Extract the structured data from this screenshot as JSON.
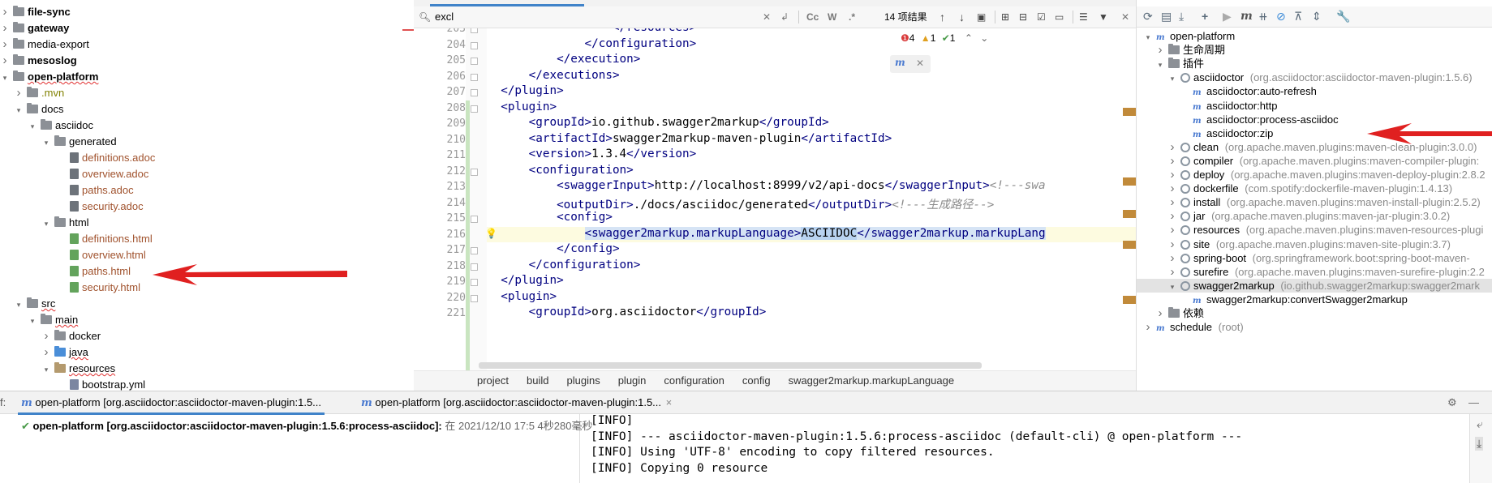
{
  "project_tree": [
    {
      "label": "file-sync",
      "style": "bold",
      "arrow": "right",
      "icon": "folder",
      "depth": 0
    },
    {
      "label": "gateway",
      "style": "bold",
      "arrow": "right",
      "icon": "folder",
      "depth": 0
    },
    {
      "label": "media-export",
      "style": "normal",
      "arrow": "right",
      "icon": "folder",
      "depth": 0
    },
    {
      "label": "mesoslog",
      "style": "bold",
      "arrow": "right",
      "icon": "folder",
      "depth": 0
    },
    {
      "label": "open-platform",
      "style": "bold-squig",
      "arrow": "down",
      "icon": "folder",
      "depth": 0
    },
    {
      "label": ".mvn",
      "style": "olive",
      "arrow": "right",
      "icon": "folder",
      "depth": 1
    },
    {
      "label": "docs",
      "style": "normal",
      "arrow": "down",
      "icon": "folder",
      "depth": 1
    },
    {
      "label": "asciidoc",
      "style": "normal",
      "arrow": "down",
      "icon": "folder",
      "depth": 2
    },
    {
      "label": "generated",
      "style": "normal",
      "arrow": "down",
      "icon": "folder",
      "depth": 3
    },
    {
      "label": "definitions.adoc",
      "style": "orange",
      "arrow": "",
      "icon": "file",
      "depth": 4
    },
    {
      "label": "overview.adoc",
      "style": "orange",
      "arrow": "",
      "icon": "file",
      "depth": 4
    },
    {
      "label": "paths.adoc",
      "style": "orange",
      "arrow": "",
      "icon": "file",
      "depth": 4
    },
    {
      "label": "security.adoc",
      "style": "orange",
      "arrow": "",
      "icon": "file",
      "depth": 4
    },
    {
      "label": "html",
      "style": "normal",
      "arrow": "down",
      "icon": "folder",
      "depth": 3
    },
    {
      "label": "definitions.html",
      "style": "orange",
      "arrow": "",
      "icon": "html",
      "depth": 4
    },
    {
      "label": "overview.html",
      "style": "orange",
      "arrow": "",
      "icon": "html",
      "depth": 4
    },
    {
      "label": "paths.html",
      "style": "orange",
      "arrow": "",
      "icon": "html",
      "depth": 4
    },
    {
      "label": "security.html",
      "style": "orange",
      "arrow": "",
      "icon": "html",
      "depth": 4
    },
    {
      "label": "src",
      "style": "squig",
      "arrow": "down",
      "icon": "folder",
      "depth": 1
    },
    {
      "label": "main",
      "style": "squig",
      "arrow": "down",
      "icon": "folder",
      "depth": 2
    },
    {
      "label": "docker",
      "style": "normal",
      "arrow": "right",
      "icon": "folder",
      "depth": 3
    },
    {
      "label": "java",
      "style": "squig",
      "arrow": "right",
      "icon": "folder-blue",
      "depth": 3
    },
    {
      "label": "resources",
      "style": "squig",
      "arrow": "down",
      "icon": "folder-tan",
      "depth": 3
    },
    {
      "label": "bootstrap.yml",
      "style": "normal",
      "arrow": "",
      "icon": "yml",
      "depth": 4
    }
  ],
  "search": {
    "value": "excl",
    "result_count": "14 项结果",
    "case_label": "Cc",
    "word_label": "W",
    "regex_label": ".*"
  },
  "inspections": {
    "errors": "4",
    "warnings": "1",
    "ok": "1"
  },
  "editor": {
    "lines": [
      {
        "n": "203",
        "parts": [
          [
            "",
            "                  "
          ],
          [
            "tg",
            "</resources>"
          ]
        ]
      },
      {
        "n": "204",
        "parts": [
          [
            "",
            "              "
          ],
          [
            "tg",
            "</configuration>"
          ]
        ]
      },
      {
        "n": "205",
        "parts": [
          [
            "",
            "          "
          ],
          [
            "tg",
            "</execution>"
          ]
        ]
      },
      {
        "n": "206",
        "parts": [
          [
            "",
            "      "
          ],
          [
            "tg",
            "</executions>"
          ]
        ]
      },
      {
        "n": "207",
        "parts": [
          [
            "",
            "  "
          ],
          [
            "tg",
            "</plugin>"
          ]
        ]
      },
      {
        "n": "208",
        "parts": [
          [
            "",
            "  "
          ],
          [
            "tg",
            "<plugin>"
          ]
        ]
      },
      {
        "n": "209",
        "parts": [
          [
            "",
            "      "
          ],
          [
            "tg",
            "<groupId>"
          ],
          [
            "",
            "io.github.swagger2markup"
          ],
          [
            "tg",
            "</groupId>"
          ]
        ]
      },
      {
        "n": "210",
        "parts": [
          [
            "",
            "      "
          ],
          [
            "tg",
            "<artifactId>"
          ],
          [
            "",
            "swagger2markup-maven-plugin"
          ],
          [
            "tg",
            "</artifactId>"
          ]
        ]
      },
      {
        "n": "211",
        "parts": [
          [
            "",
            "      "
          ],
          [
            "tg",
            "<version>"
          ],
          [
            "",
            "1.3.4"
          ],
          [
            "tg",
            "</version>"
          ]
        ]
      },
      {
        "n": "212",
        "parts": [
          [
            "",
            "      "
          ],
          [
            "tg",
            "<configuration>"
          ]
        ]
      },
      {
        "n": "213",
        "parts": [
          [
            "",
            "          "
          ],
          [
            "tg",
            "<swaggerInput>"
          ],
          [
            "",
            "http://localhost:8999/v2/api-docs"
          ],
          [
            "tg",
            "</swaggerInput>"
          ],
          [
            "cm",
            "<!---swa"
          ]
        ]
      },
      {
        "n": "214",
        "parts": [
          [
            "",
            "          "
          ],
          [
            "tg",
            "<outputDir>"
          ],
          [
            "",
            "./docs/asciidoc/generated"
          ],
          [
            "tg",
            "</outputDir>"
          ],
          [
            "cm",
            "<!---生成路径-->"
          ]
        ]
      },
      {
        "n": "215",
        "parts": [
          [
            "",
            "          "
          ],
          [
            "tg",
            "<config>"
          ]
        ]
      },
      {
        "n": "216",
        "parts": [
          [
            "",
            "              "
          ],
          [
            "tg hl",
            "<swagger2markup.markupLanguage>"
          ],
          [
            "hls",
            "ASCIIDOC"
          ],
          [
            "tg hl",
            "</swagger2markup.markupLang"
          ]
        ]
      },
      {
        "n": "217",
        "parts": [
          [
            "",
            "          "
          ],
          [
            "tg",
            "</config>"
          ]
        ]
      },
      {
        "n": "218",
        "parts": [
          [
            "",
            "      "
          ],
          [
            "tg",
            "</configuration>"
          ]
        ]
      },
      {
        "n": "219",
        "parts": [
          [
            "",
            "  "
          ],
          [
            "tg",
            "</plugin>"
          ]
        ]
      },
      {
        "n": "220",
        "parts": [
          [
            "",
            "  "
          ],
          [
            "tg",
            "<plugin>"
          ]
        ]
      },
      {
        "n": "221",
        "parts": [
          [
            "",
            "      "
          ],
          [
            "tg",
            "<groupId>"
          ],
          [
            "",
            "org.asciidoctor"
          ],
          [
            "tg",
            "</groupId>"
          ]
        ]
      }
    ]
  },
  "breadcrumb": [
    "project",
    "build",
    "plugins",
    "plugin",
    "configuration",
    "config",
    "swagger2markup.markupLanguage"
  ],
  "maven": {
    "rows": [
      {
        "label": "open-platform",
        "sub": "",
        "arrow": "down",
        "icon": "module",
        "depth": 0
      },
      {
        "label": "生命周期",
        "sub": "",
        "arrow": "right",
        "icon": "folder",
        "depth": 1
      },
      {
        "label": "插件",
        "sub": "",
        "arrow": "down",
        "icon": "folder",
        "depth": 1
      },
      {
        "label": "asciidoctor",
        "sub": "(org.asciidoctor:asciidoctor-maven-plugin:1.5.6)",
        "arrow": "down",
        "icon": "gear",
        "depth": 2
      },
      {
        "label": "asciidoctor:auto-refresh",
        "sub": "",
        "arrow": "",
        "icon": "goal",
        "depth": 3
      },
      {
        "label": "asciidoctor:http",
        "sub": "",
        "arrow": "",
        "icon": "goal",
        "depth": 3
      },
      {
        "label": "asciidoctor:process-asciidoc",
        "sub": "",
        "arrow": "",
        "icon": "goal",
        "depth": 3
      },
      {
        "label": "asciidoctor:zip",
        "sub": "",
        "arrow": "",
        "icon": "goal",
        "depth": 3
      },
      {
        "label": "clean",
        "sub": "(org.apache.maven.plugins:maven-clean-plugin:3.0.0)",
        "arrow": "right",
        "icon": "gear",
        "depth": 2
      },
      {
        "label": "compiler",
        "sub": "(org.apache.maven.plugins:maven-compiler-plugin:",
        "arrow": "right",
        "icon": "gear",
        "depth": 2
      },
      {
        "label": "deploy",
        "sub": "(org.apache.maven.plugins:maven-deploy-plugin:2.8.2",
        "arrow": "right",
        "icon": "gear",
        "depth": 2
      },
      {
        "label": "dockerfile",
        "sub": "(com.spotify:dockerfile-maven-plugin:1.4.13)",
        "arrow": "right",
        "icon": "gear",
        "depth": 2
      },
      {
        "label": "install",
        "sub": "(org.apache.maven.plugins:maven-install-plugin:2.5.2)",
        "arrow": "right",
        "icon": "gear",
        "depth": 2
      },
      {
        "label": "jar",
        "sub": "(org.apache.maven.plugins:maven-jar-plugin:3.0.2)",
        "arrow": "right",
        "icon": "gear",
        "depth": 2
      },
      {
        "label": "resources",
        "sub": "(org.apache.maven.plugins:maven-resources-plugi",
        "arrow": "right",
        "icon": "gear",
        "depth": 2
      },
      {
        "label": "site",
        "sub": "(org.apache.maven.plugins:maven-site-plugin:3.7)",
        "arrow": "right",
        "icon": "gear",
        "depth": 2
      },
      {
        "label": "spring-boot",
        "sub": "(org.springframework.boot:spring-boot-maven-",
        "arrow": "right",
        "icon": "gear",
        "depth": 2
      },
      {
        "label": "surefire",
        "sub": "(org.apache.maven.plugins:maven-surefire-plugin:2.2",
        "arrow": "right",
        "icon": "gear",
        "depth": 2
      },
      {
        "label": "swagger2markup",
        "sub": "(io.github.swagger2markup:swagger2mark",
        "arrow": "down",
        "icon": "gear",
        "depth": 2,
        "selected": true
      },
      {
        "label": "swagger2markup:convertSwagger2markup",
        "sub": "",
        "arrow": "",
        "icon": "goal",
        "depth": 3
      },
      {
        "label": "依赖",
        "sub": "",
        "arrow": "right",
        "icon": "folder",
        "depth": 1
      },
      {
        "label": "schedule",
        "sub": "(root)",
        "arrow": "right",
        "icon": "module",
        "depth": 0
      }
    ]
  },
  "run": {
    "tab1": "open-platform [org.asciidoctor:asciidoctor-maven-plugin:1.5...",
    "tab2": "open-platform [org.asciidoctor:asciidoctor-maven-plugin:1.5...",
    "tab_prefix": "f:",
    "tab2_close": "×",
    "result_title": "open-platform [org.asciidoctor:asciidoctor-maven-plugin:1.5.6:process-asciidoc]:",
    "result_time": " 在 2021/12/10 17:5 4秒280毫秒",
    "console": [
      "[INFO]",
      "[INFO] --- asciidoctor-maven-plugin:1.5.6:process-asciidoc (default-cli) @ open-platform ---",
      "[INFO] Using 'UTF-8' encoding to copy filtered resources.",
      "[INFO] Copying 0 resource"
    ]
  },
  "colors": {
    "annotation_arrow": "#e02020",
    "accent": "#4083c9"
  }
}
